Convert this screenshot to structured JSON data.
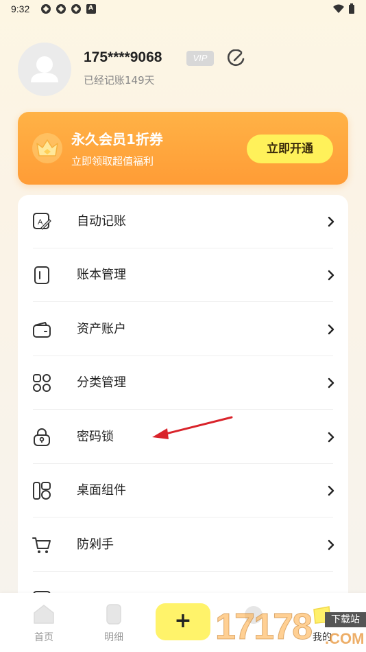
{
  "status_bar": {
    "time": "9:32"
  },
  "profile": {
    "username": "175****9068",
    "vip_label": "VIP",
    "days_text": "已经记账149天"
  },
  "vip_banner": {
    "title": "永久会员1折券",
    "subtitle": "立即领取超值福利",
    "button": "立即开通"
  },
  "menu": {
    "items": [
      {
        "label": "自动记账",
        "icon": "auto-record-icon"
      },
      {
        "label": "账本管理",
        "icon": "ledger-icon"
      },
      {
        "label": "资产账户",
        "icon": "wallet-icon"
      },
      {
        "label": "分类管理",
        "icon": "category-icon"
      },
      {
        "label": "密码锁",
        "icon": "lock-icon"
      },
      {
        "label": "桌面组件",
        "icon": "widget-icon"
      },
      {
        "label": "防剁手",
        "icon": "cart-icon"
      }
    ]
  },
  "tabbar": {
    "items": [
      {
        "label": "首页",
        "icon": "home-icon"
      },
      {
        "label": "明细",
        "icon": "details-icon"
      },
      {
        "label": "+",
        "icon": "plus-icon"
      },
      {
        "label": "我的",
        "icon": "profile-icon"
      }
    ]
  },
  "watermark": {
    "digits": "17178",
    "site_label": "下载站",
    "domain": ".COM"
  },
  "colors": {
    "accent_orange": "#ff9c36",
    "accent_yellow": "#fff36a",
    "arrow_red": "#d9232a"
  }
}
